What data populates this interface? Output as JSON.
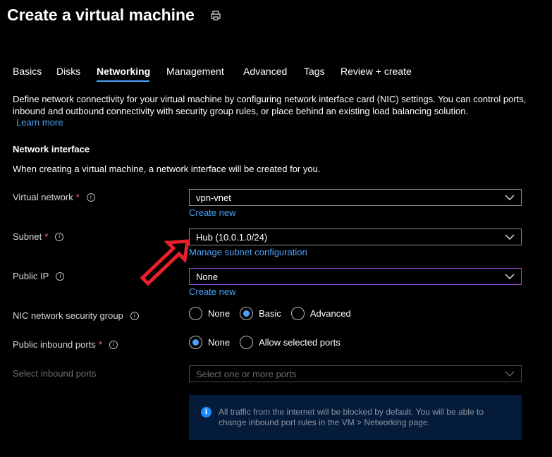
{
  "page": {
    "title": "Create a virtual machine",
    "print_icon": "print-icon"
  },
  "tabs": [
    {
      "label": "Basics"
    },
    {
      "label": "Disks"
    },
    {
      "label": "Networking"
    },
    {
      "label": "Management"
    },
    {
      "label": "Advanced"
    },
    {
      "label": "Tags"
    },
    {
      "label": "Review + create"
    }
  ],
  "intro": {
    "text": "Define network connectivity for your virtual machine by configuring network interface card (NIC) settings. You can control ports, inbound and outbound connectivity with security group rules, or place behind an existing load balancing solution.",
    "learn_more": "Learn more"
  },
  "section": {
    "heading": "Network interface",
    "subtext": "When creating a virtual machine, a network interface will be created for you."
  },
  "fields": {
    "vnet": {
      "label": "Virtual network",
      "value": "vpn-vnet",
      "link": "Create new"
    },
    "subnet": {
      "label": "Subnet",
      "value": "Hub (10.0.1.0/24)",
      "link": "Manage subnet configuration"
    },
    "public_ip": {
      "label": "Public IP",
      "value": "None",
      "link": "Create new"
    },
    "nsg": {
      "label": "NIC network security group",
      "options": [
        "None",
        "Basic",
        "Advanced"
      ],
      "selected": "Basic"
    },
    "inbound": {
      "label": "Public inbound ports",
      "options": [
        "None",
        "Allow selected ports"
      ],
      "selected": "None"
    },
    "ports": {
      "label": "Select inbound ports",
      "placeholder": "Select one or more ports"
    }
  },
  "info_box": {
    "text": "All traffic from the internet will be blocked by default. You will be able to change inbound port rules in the VM > Networking page."
  },
  "colors": {
    "accent": "#4aa4ff",
    "annotation": "#e8202a",
    "required": "#f1707b"
  }
}
